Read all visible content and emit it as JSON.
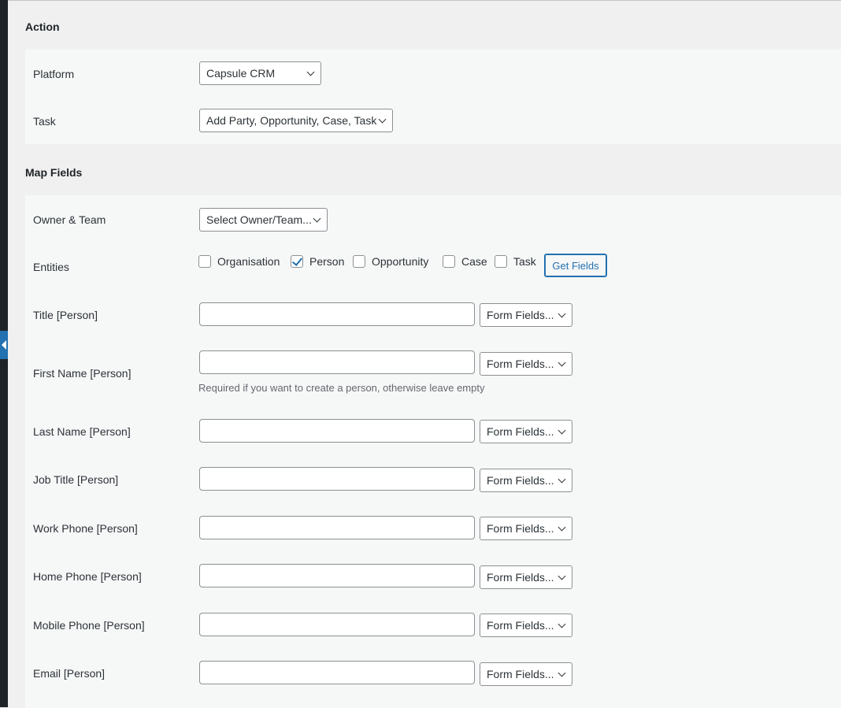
{
  "action_section": {
    "heading": "Action",
    "platform": {
      "label": "Platform",
      "value": "Capsule CRM"
    },
    "task": {
      "label": "Task",
      "value": "Add Party, Opportunity, Case, Task"
    }
  },
  "map_fields_section": {
    "heading": "Map Fields",
    "owner_team": {
      "label": "Owner & Team",
      "value": "Select Owner/Team..."
    },
    "entities": {
      "label": "Entities",
      "options": [
        {
          "label": "Organisation",
          "checked": false
        },
        {
          "label": "Person",
          "checked": true
        },
        {
          "label": "Opportunity",
          "checked": false
        },
        {
          "label": "Case",
          "checked": false
        },
        {
          "label": "Task",
          "checked": false
        }
      ],
      "button_label": "Get Fields"
    },
    "fields": [
      {
        "label": "Title [Person]",
        "input_value": "",
        "select_value": "Form Fields..."
      },
      {
        "label": "First Name [Person]",
        "input_value": "",
        "select_value": "Form Fields...",
        "help": "Required if you want to create a person, otherwise leave empty"
      },
      {
        "label": "Last Name [Person]",
        "input_value": "",
        "select_value": "Form Fields..."
      },
      {
        "label": "Job Title [Person]",
        "input_value": "",
        "select_value": "Form Fields..."
      },
      {
        "label": "Work Phone [Person]",
        "input_value": "",
        "select_value": "Form Fields..."
      },
      {
        "label": "Home Phone [Person]",
        "input_value": "",
        "select_value": "Form Fields..."
      },
      {
        "label": "Mobile Phone [Person]",
        "input_value": "",
        "select_value": "Form Fields..."
      },
      {
        "label": "Email [Person]",
        "input_value": "",
        "select_value": "Form Fields..."
      }
    ]
  },
  "colors": {
    "sidebar_bg": "#1d2327",
    "accent": "#2271b1",
    "panel_bg": "#f6f7f7",
    "page_bg": "#f0f0f1"
  }
}
